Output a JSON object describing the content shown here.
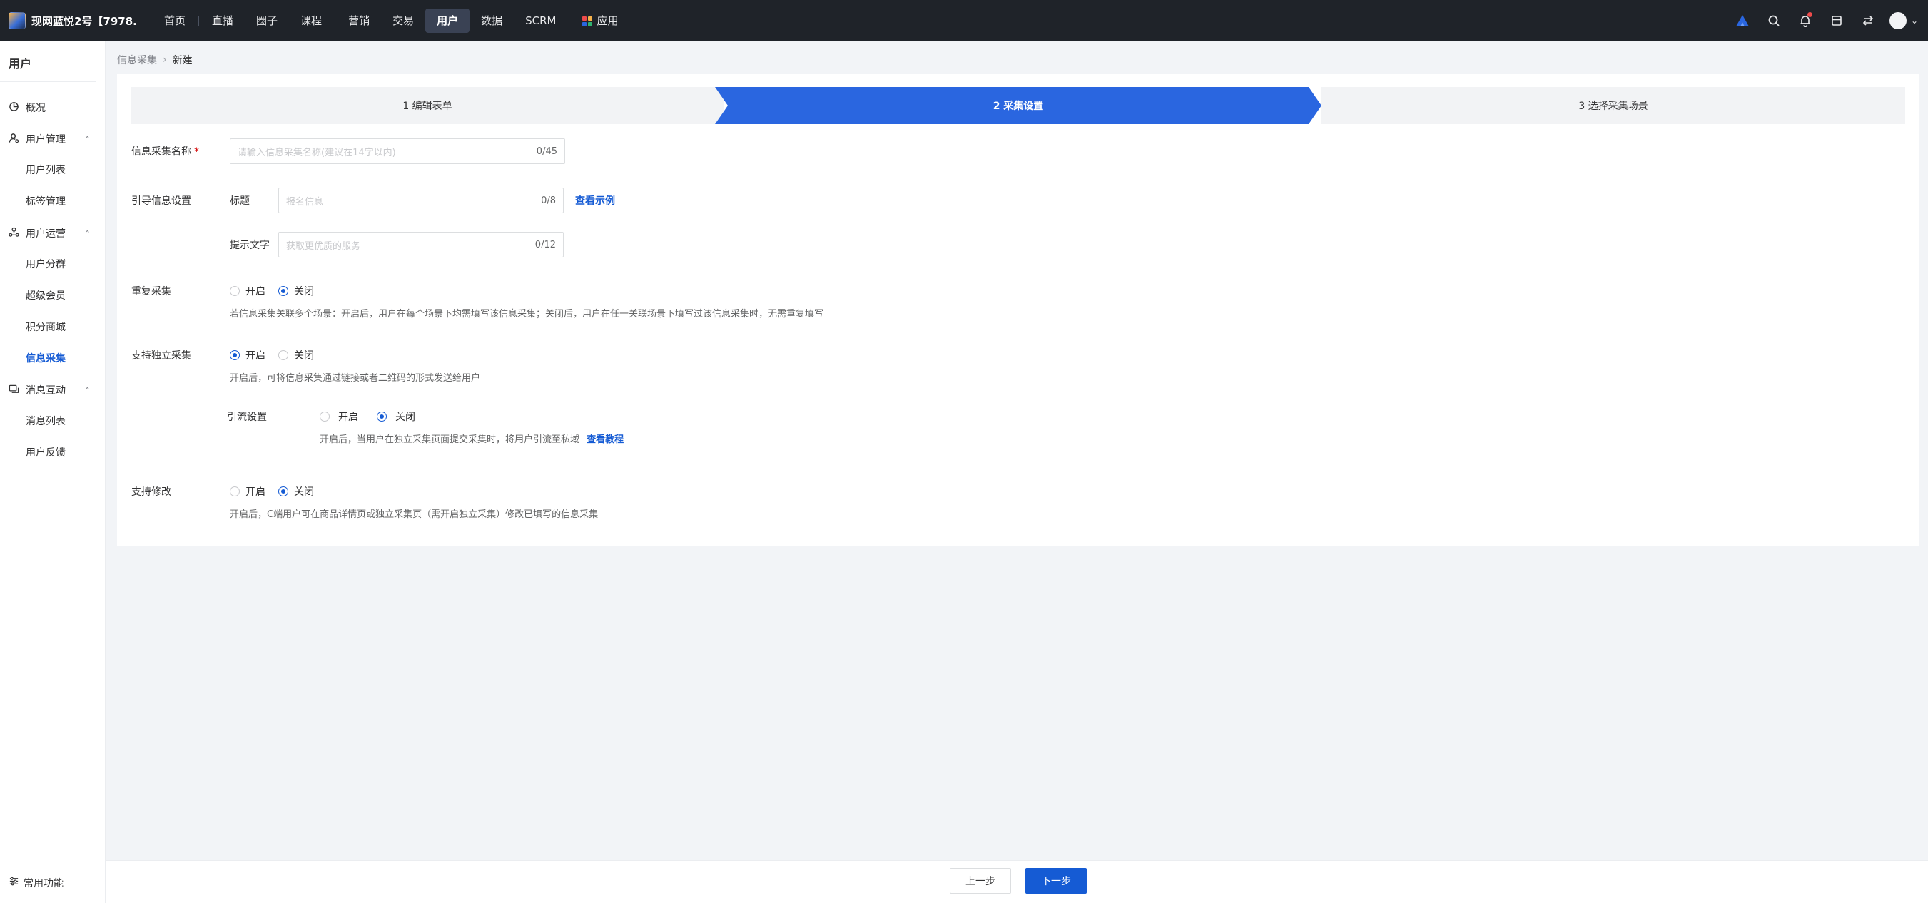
{
  "topbar": {
    "shop_name": "现网蓝悦2号【7978...",
    "nav": [
      "首页",
      "直播",
      "圈子",
      "课程",
      "营销",
      "交易",
      "用户",
      "数据",
      "SCRM",
      "应用"
    ],
    "active_nav": "用户",
    "colors": {
      "bg": "#1f2329",
      "active": "#3a4254"
    }
  },
  "sidebar": {
    "title": "用户",
    "overview": "概况",
    "group_user_mgmt": "用户管理",
    "user_list": "用户列表",
    "tag_mgmt": "标签管理",
    "group_user_ops": "用户运营",
    "user_segment": "用户分群",
    "super_member": "超级会员",
    "points_mall": "积分商城",
    "info_collect": "信息采集",
    "group_message": "消息互动",
    "message_list": "消息列表",
    "user_feedback": "用户反馈",
    "common_functions": "常用功能"
  },
  "breadcrumb": {
    "parent": "信息采集",
    "current": "新建"
  },
  "steps": {
    "step1": "1 编辑表单",
    "step2": "2 采集设置",
    "step3": "3 选择采集场景",
    "active_color": "#2a66e0"
  },
  "form": {
    "name": {
      "label": "信息采集名称",
      "required_mark": "*",
      "placeholder": "请输入信息采集名称(建议在14字以内)",
      "count": "0/45"
    },
    "guide": {
      "label": "引导信息设置",
      "title_label": "标题",
      "title_placeholder": "报名信息",
      "title_count": "0/8",
      "view_example": "查看示例",
      "tip_label": "提示文字",
      "tip_placeholder": "获取更优质的服务",
      "tip_count": "0/12"
    },
    "repeat": {
      "label": "重复采集",
      "on": "开启",
      "off": "关闭",
      "help": "若信息采集关联多个场景：开启后，用户在每个场景下均需填写该信息采集；关闭后，用户在任一关联场景下填写过该信息采集时，无需重复填写"
    },
    "standalone": {
      "label": "支持独立采集",
      "on": "开启",
      "off": "关闭",
      "help": "开启后，可将信息采集通过链接或者二维码的形式发送给用户",
      "traffic_label": "引流设置",
      "traffic_on": "开启",
      "traffic_off": "关闭",
      "traffic_help": "开启后，当用户在独立采集页面提交采集时，将用户引流至私域",
      "traffic_link": "查看教程"
    },
    "modify": {
      "label": "支持修改",
      "on": "开启",
      "off": "关闭",
      "help": "开启后，C端用户可在商品详情页或独立采集页（需开启独立采集）修改已填写的信息采集"
    }
  },
  "footer": {
    "prev": "上一步",
    "next": "下一步"
  },
  "icons": [
    "search-icon",
    "bell-icon",
    "store-icon",
    "switch-icon",
    "brand-icon",
    "chevron-up-icon",
    "chevron-down-icon"
  ]
}
